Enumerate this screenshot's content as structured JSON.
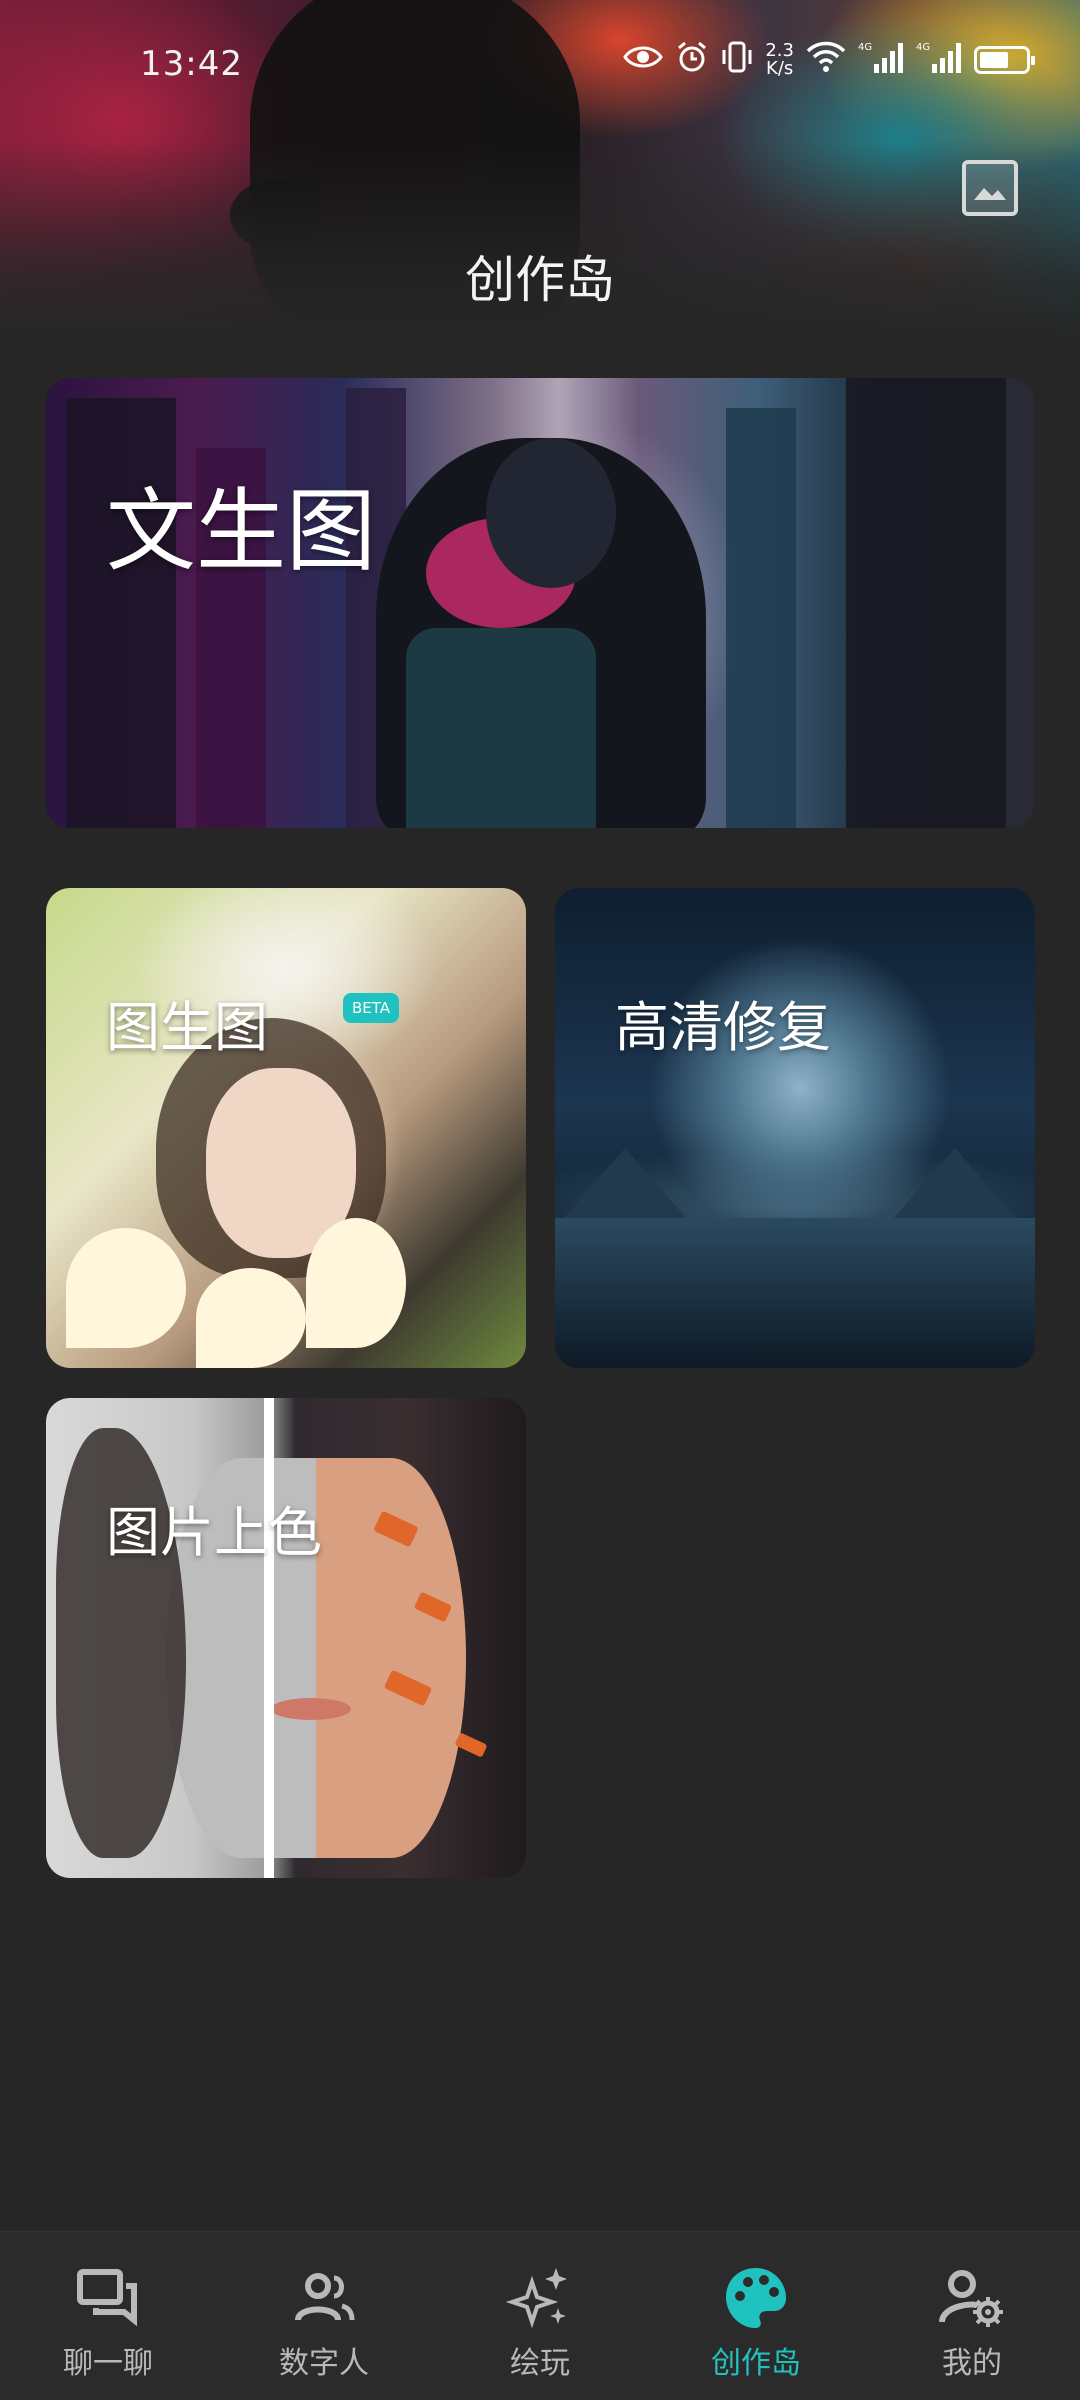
{
  "status_bar": {
    "time": "13:42",
    "net_speed_value": "2.3",
    "net_speed_unit": "K/s",
    "signal_1_label": "4G",
    "signal_2_label": "4G",
    "icons": [
      "eye-icon",
      "alarm-icon",
      "vibrate-icon",
      "wifi-icon",
      "signal-icon",
      "signal-icon",
      "battery-icon"
    ]
  },
  "header": {
    "title": "创作岛",
    "gallery_icon": "image-icon"
  },
  "cards": {
    "text_to_image": {
      "label": "文生图"
    },
    "image_to_image": {
      "label": "图生图",
      "badge": "BETA"
    },
    "hd_restore": {
      "label": "高清修复"
    },
    "colorize": {
      "label": "图片上色"
    }
  },
  "nav": {
    "items": [
      {
        "label": "聊一聊",
        "icon": "chat-icon"
      },
      {
        "label": "数字人",
        "icon": "people-icon"
      },
      {
        "label": "绘玩",
        "icon": "sparkle-icon"
      },
      {
        "label": "创作岛",
        "icon": "palette-icon"
      },
      {
        "label": "我的",
        "icon": "profile-settings-icon"
      }
    ],
    "active_index": 3
  },
  "colors": {
    "background": "#262626",
    "accent": "#20c2bf",
    "nav_inactive": "#b9b9b9",
    "nav_background": "#2b2b2b"
  }
}
